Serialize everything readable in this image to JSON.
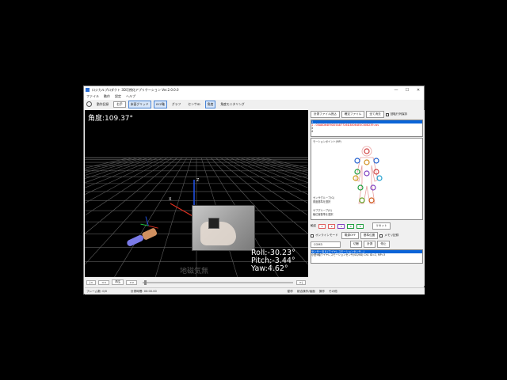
{
  "window": {
    "title": "ロジカルプロダクト 3D可視化アプリケーション Ver.2.0.0.0",
    "minimize": "—",
    "maximize": "☐",
    "close": "✕"
  },
  "menu": [
    "ファイル",
    "動作",
    "設定",
    "ヘルプ"
  ],
  "toolbar": {
    "record_label": "動作記録",
    "hand_select": "右手",
    "items": [
      {
        "label": "床面グリッド",
        "active": true
      },
      {
        "label": "XYZ軸",
        "active": true
      },
      {
        "label": "グラフ",
        "active": false
      },
      {
        "label": "センサID",
        "active": false
      },
      {
        "label": "角度",
        "active": true
      },
      {
        "label": "角度モニタリング",
        "active": false
      }
    ]
  },
  "view": {
    "angle": "角度:109.37°",
    "roll": "Roll:-30.23°",
    "pitch": "Pitch:-3.44°",
    "yaw": "Yaw:4.62°",
    "watermark": "地磁気無",
    "axis_x": "X",
    "axis_z": "Z"
  },
  "playback": {
    "buttons": [
      "|<",
      "<<",
      "再生",
      ">>"
    ],
    "end_button": ">|"
  },
  "status": {
    "frame": "フレーム数: 0/0",
    "time": "計測時間: 00:00.00"
  },
  "right_panel": {
    "load_file_button": "計測ファイル読込",
    "confirm_file_button": "確定ファイル",
    "clear_all_button": "全て消去",
    "rotate_save_label": "回転行列保存",
    "file_list": [
      {
        "text": "1",
        "style": "hl"
      },
      {
        "text": "1 - 00A8D64E9D05A87726D38064E0C608239.csv",
        "style": "red"
      },
      {
        "text": "3",
        "style": ""
      },
      {
        "text": "4",
        "style": ""
      }
    ],
    "motion_point_label": "モーションポイント(MP)",
    "sensor_group_label": "センサグループ(G)",
    "sensor_group_value": "角度基準を選択",
    "secondary_label": "サブグループ(G)",
    "secondary_value": "軸位置基準を選択",
    "color_label": "軸定",
    "color_slots": [
      "1",
      "2",
      "3",
      "4",
      "5"
    ],
    "reset_button": "リセット",
    "online_mode_label": "オンラインモード",
    "power_button": "電源OFF",
    "baseline_button": "基準位置",
    "memory_label": "メモリ記録",
    "com_select": "COM3",
    "connect_button": "切断",
    "measure_button": "計測",
    "stop_button": "停止",
    "device_list": [
      {
        "text": "センサーID 8 (ワイヤレスモーションセンサ...)",
        "style": "hl"
      },
      {
        "text": "小型9軸ワイヤレスモーションセンサ(SG/9D) Ch1 ID=2, MP=3",
        "style": ""
      }
    ],
    "tabs": [
      "動作",
      "統合操作/画面",
      "操作",
      "その他"
    ]
  },
  "colors": {
    "accent": "#0a64d8",
    "grid": "#6a6a6a",
    "axis_x": "#e03020",
    "axis_y": "#20c040",
    "axis_z": "#2050e0"
  }
}
